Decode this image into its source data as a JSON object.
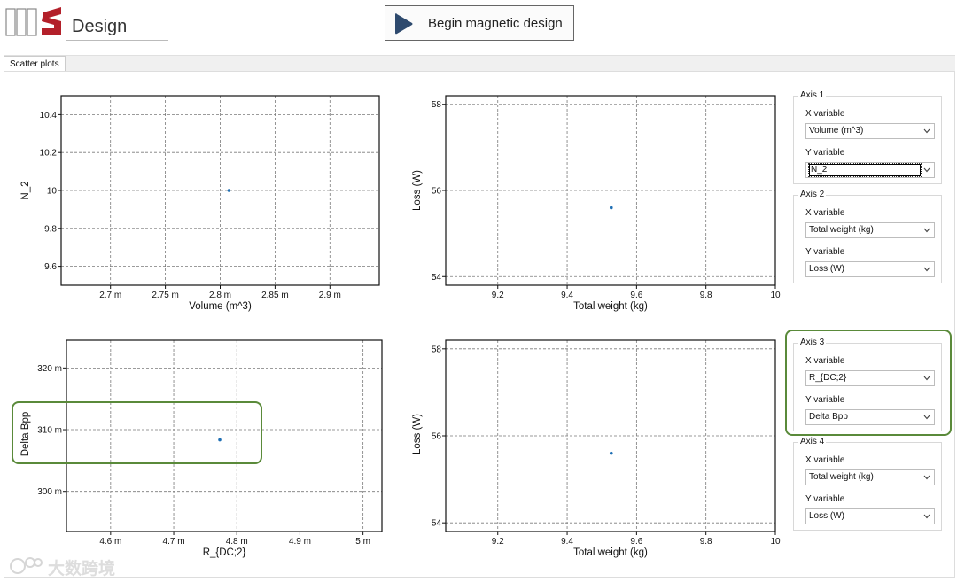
{
  "app": {
    "brand": "Design",
    "brand_mark_icon": "logo-mark-icon",
    "begin_button_label": "Begin magnetic design",
    "begin_button_icon": "play-triangle-icon",
    "accent_color": "#2e4a6e"
  },
  "tabs": [
    {
      "label": "Scatter plots",
      "active": true
    }
  ],
  "chart_data": [
    {
      "type": "scatter",
      "xlabel": "Volume (m^3)",
      "ylabel": "N_2",
      "x_ticks": [
        "2.7 m",
        "2.75 m",
        "2.8 m",
        "2.85 m",
        "2.9 m"
      ],
      "y_ticks": [
        "9.6",
        "9.8",
        "10",
        "10.2",
        "10.4"
      ],
      "xlim": [
        0.002655,
        0.002945
      ],
      "ylim": [
        9.5,
        10.5
      ],
      "grid": true,
      "points": [
        {
          "x": 0.002808,
          "y": 10.0
        }
      ]
    },
    {
      "type": "scatter",
      "xlabel": "Total weight (kg)",
      "ylabel": "Loss (W)",
      "x_ticks": [
        "9.2",
        "9.4",
        "9.6",
        "9.8",
        "10"
      ],
      "y_ticks": [
        "54",
        "56",
        "58"
      ],
      "xlim": [
        9.05,
        10.0
      ],
      "ylim": [
        53.8,
        58.2
      ],
      "grid": true,
      "points": [
        {
          "x": 9.527,
          "y": 55.6
        }
      ]
    },
    {
      "type": "scatter",
      "xlabel": "R_{DC;2}",
      "ylabel": "Delta Bpp",
      "x_ticks": [
        "4.6 m",
        "4.7 m",
        "4.8 m",
        "4.9 m",
        "5 m"
      ],
      "y_ticks": [
        "300 m",
        "310 m",
        "320 m"
      ],
      "xlim": [
        0.00453,
        0.00503
      ],
      "ylim": [
        0.2935,
        0.3245
      ],
      "grid": true,
      "points": [
        {
          "x": 0.004773,
          "y": 0.30835
        }
      ]
    },
    {
      "type": "scatter",
      "xlabel": "Total weight (kg)",
      "ylabel": "Loss (W)",
      "x_ticks": [
        "9.2",
        "9.4",
        "9.6",
        "9.8",
        "10"
      ],
      "y_ticks": [
        "54",
        "56",
        "58"
      ],
      "xlim": [
        9.05,
        10.0
      ],
      "ylim": [
        53.8,
        58.2
      ],
      "grid": true,
      "points": [
        {
          "x": 9.527,
          "y": 55.6
        }
      ]
    }
  ],
  "axes_settings": {
    "x_variable_label": "X variable",
    "y_variable_label": "Y variable",
    "groups": [
      {
        "title": "Axis 1",
        "x": "Volume (m^3)",
        "y": "N_2"
      },
      {
        "title": "Axis 2",
        "x": "Total weight (kg)",
        "y": "Loss (W)"
      },
      {
        "title": "Axis 3",
        "x": "R_{DC;2}",
        "y": "Delta Bpp"
      },
      {
        "title": "Axis 4",
        "x": "Total weight (kg)",
        "y": "Loss (W)"
      }
    ]
  },
  "watermark": {
    "text": "大数跨境"
  },
  "colors": {
    "point": "#1f6fb4",
    "highlight": "#5a8a3a",
    "grid": "#7a7a7a"
  }
}
